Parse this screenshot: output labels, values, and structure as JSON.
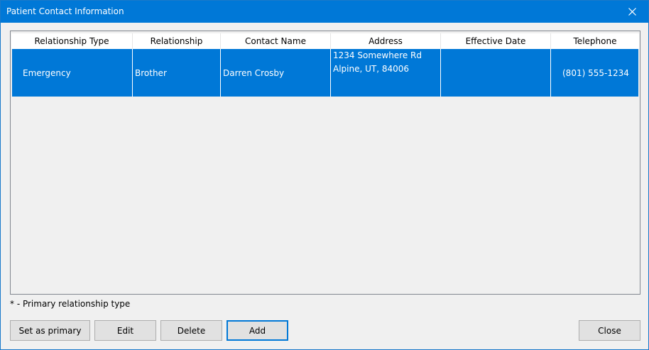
{
  "window": {
    "title": "Patient Contact Information"
  },
  "table": {
    "columns": [
      "Relationship Type",
      "Relationship",
      "Contact Name",
      "Address",
      "Effective Date",
      "Telephone"
    ],
    "rows": [
      {
        "relationship_type": "Emergency",
        "relationship": "Brother",
        "contact_name": "Darren Crosby",
        "address_line1": "1234 Somewhere Rd",
        "address_line2": "Alpine, UT, 84006",
        "effective_date": "",
        "telephone": "(801) 555-1234"
      }
    ]
  },
  "note": "* - Primary relationship type",
  "buttons": {
    "set_primary": "Set as primary",
    "edit": "Edit",
    "delete": "Delete",
    "add": "Add",
    "close": "Close"
  },
  "colors": {
    "selection": "#0078d7",
    "titlebar": "#0078d7"
  },
  "icons": {
    "close": "close-icon"
  }
}
